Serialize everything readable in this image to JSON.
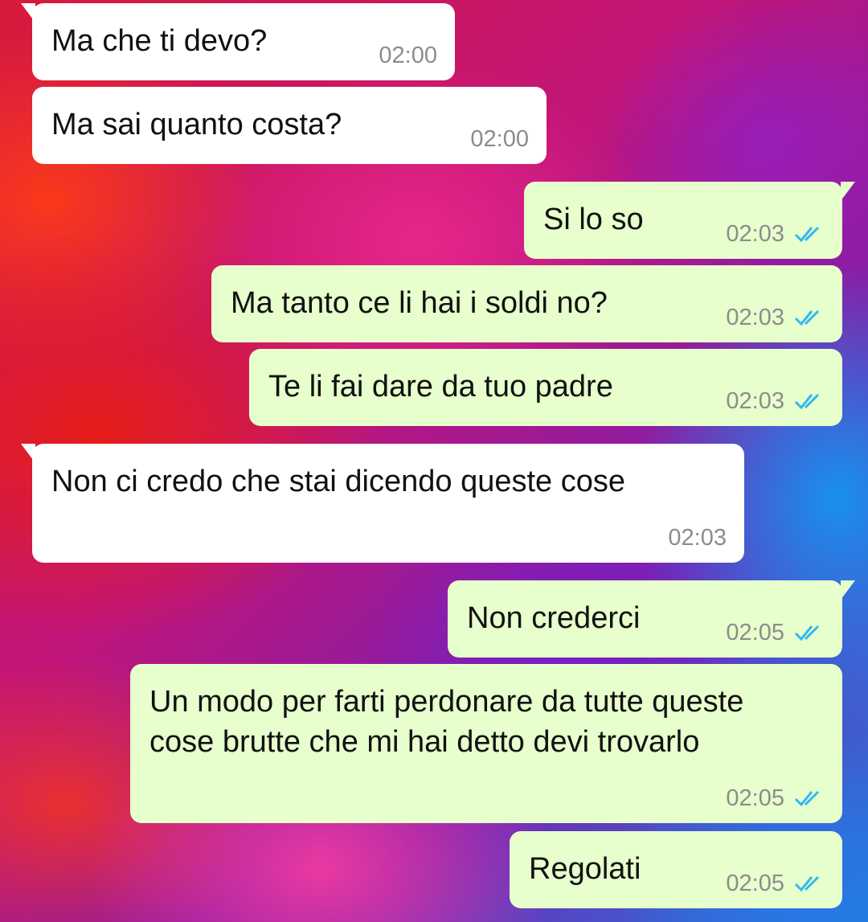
{
  "messages": [
    {
      "text": "Ma che ti devo?",
      "time": "02:00",
      "direction": "incoming"
    },
    {
      "text": "Ma sai quanto costa?",
      "time": "02:00",
      "direction": "incoming"
    },
    {
      "text": "Si lo so",
      "time": "02:03",
      "direction": "outgoing",
      "status": "read"
    },
    {
      "text": "Ma tanto ce li hai i soldi no?",
      "time": "02:03",
      "direction": "outgoing",
      "status": "read"
    },
    {
      "text": "Te li fai dare da tuo padre",
      "time": "02:03",
      "direction": "outgoing",
      "status": "read"
    },
    {
      "text": "Non ci credo che stai dicendo queste cose",
      "time": "02:03",
      "direction": "incoming"
    },
    {
      "text": "Non crederci",
      "time": "02:05",
      "direction": "outgoing",
      "status": "read"
    },
    {
      "text": "Un modo per farti perdonare da tutte queste cose brutte che mi hai detto devi trovarlo",
      "time": "02:05",
      "direction": "outgoing",
      "status": "read"
    },
    {
      "text": "Regolati",
      "time": "02:05",
      "direction": "outgoing",
      "status": "read"
    }
  ],
  "colors": {
    "incoming_bubble": "#ffffff",
    "outgoing_bubble": "#e6ffcc",
    "read_tick": "#34b7f1",
    "timestamp": "#8c8c8c"
  },
  "icons": {
    "read_receipt": "double-check-icon"
  }
}
